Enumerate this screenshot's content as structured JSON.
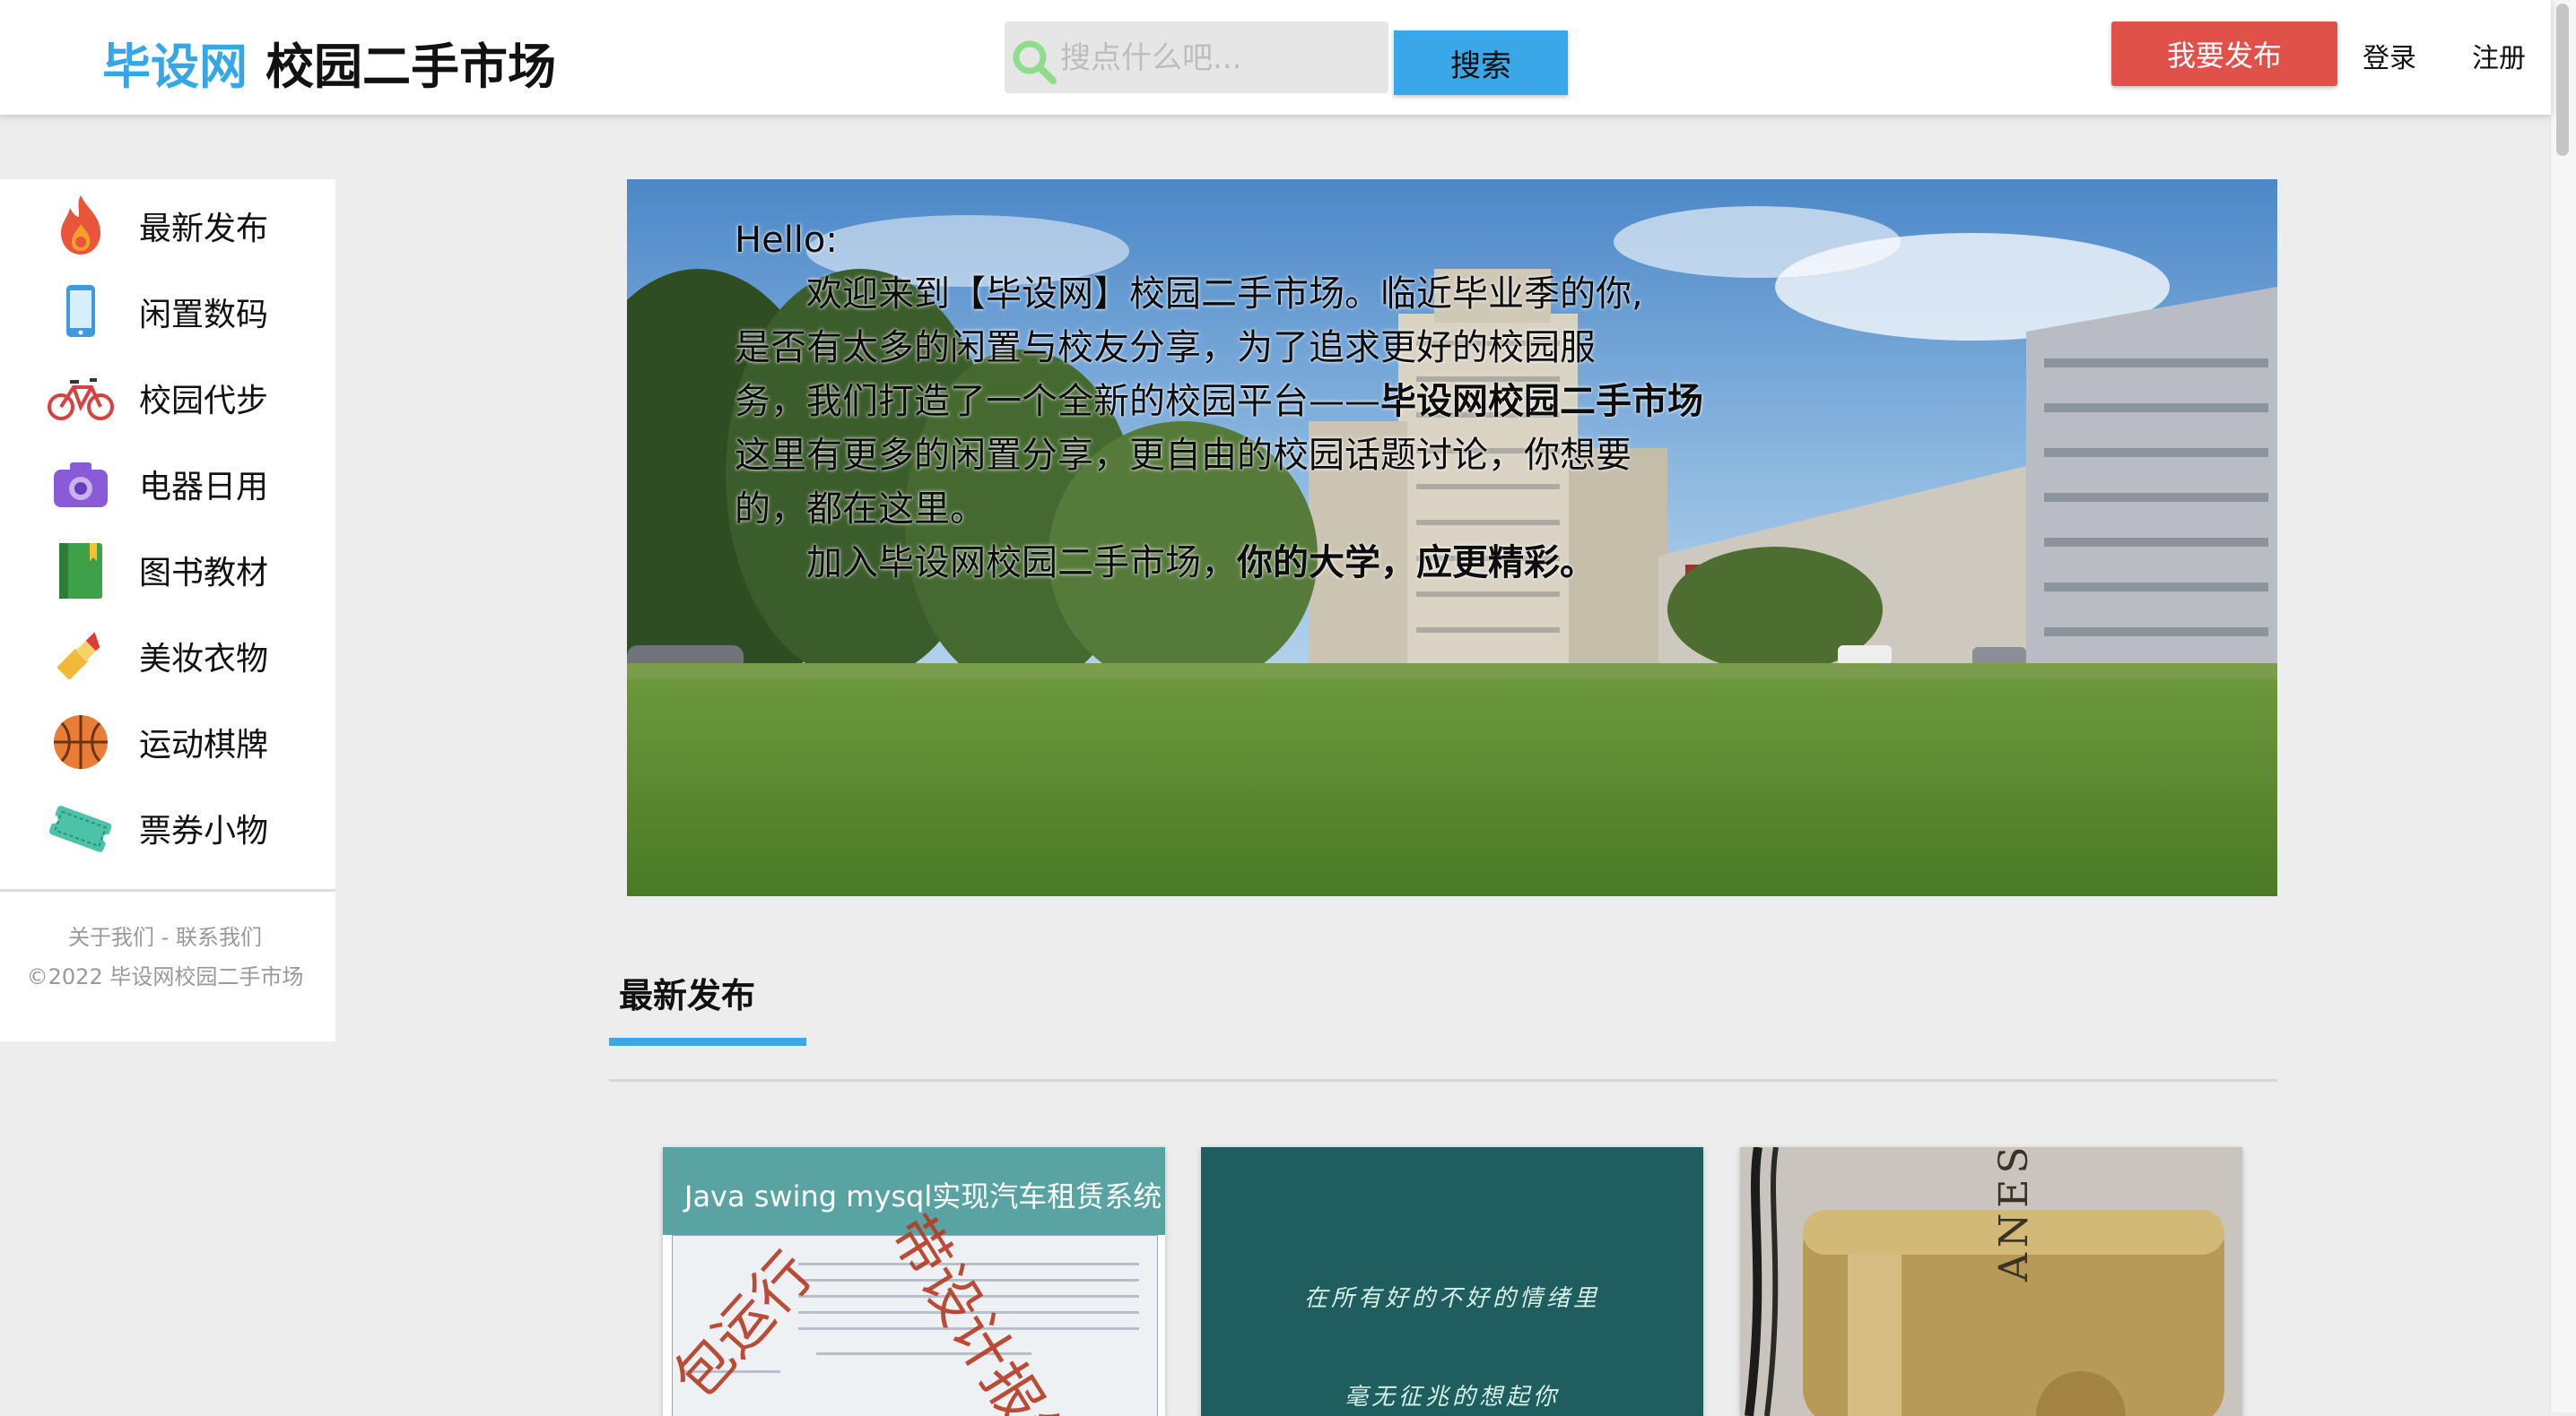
{
  "header": {
    "logo_brand": "毕设网",
    "logo_sub": "校园二手市场",
    "search_placeholder": "搜点什么吧...",
    "search_button": "搜索",
    "publish_button": "我要发布",
    "login": "登录",
    "register": "注册"
  },
  "sidebar": {
    "items": [
      {
        "label": "最新发布",
        "icon": "fire-icon"
      },
      {
        "label": "闲置数码",
        "icon": "phone-icon"
      },
      {
        "label": "校园代步",
        "icon": "bicycle-icon"
      },
      {
        "label": "电器日用",
        "icon": "camera-icon"
      },
      {
        "label": "图书教材",
        "icon": "book-icon"
      },
      {
        "label": "美妆衣物",
        "icon": "lipstick-icon"
      },
      {
        "label": "运动棋牌",
        "icon": "basketball-icon"
      },
      {
        "label": "票券小物",
        "icon": "ticket-icon"
      }
    ],
    "footer_about": "关于我们",
    "footer_sep": " - ",
    "footer_contact": "联系我们",
    "copyright": "©2022 毕设网校园二手市场"
  },
  "banner": {
    "line1": "Hello:",
    "line2": "欢迎来到【毕设网】校园二手市场。临近毕业季的你,",
    "line3": "是否有太多的闲置与校友分享，为了追求更好的校园服",
    "line4a": "务，我们打造了一个全新的校园平台——",
    "line4b": "毕设网校园二手市场",
    "line5": "这里有更多的闲置分享，更自由的校园话题讨论，你想要",
    "line6": "的，都在这里。",
    "line7a": "加入毕设网校园二手市场，",
    "line7b": "你的大学，应更精彩。"
  },
  "latest": {
    "title": "最新发布",
    "cards": [
      {
        "title": "Java swing mysql实现汽车租赁系统",
        "stamp_a": "包运行",
        "stamp_b": "带设计报告"
      },
      {
        "line1": "在所有好的不好的情绪里",
        "line2": "毫无征兆的想起你"
      },
      {
        "label": "ANESSA"
      }
    ]
  },
  "colors": {
    "brand_blue": "#35a6e6",
    "publish_red": "#e0514a",
    "search_blue": "#3aa8e8",
    "background": "#ededed"
  }
}
